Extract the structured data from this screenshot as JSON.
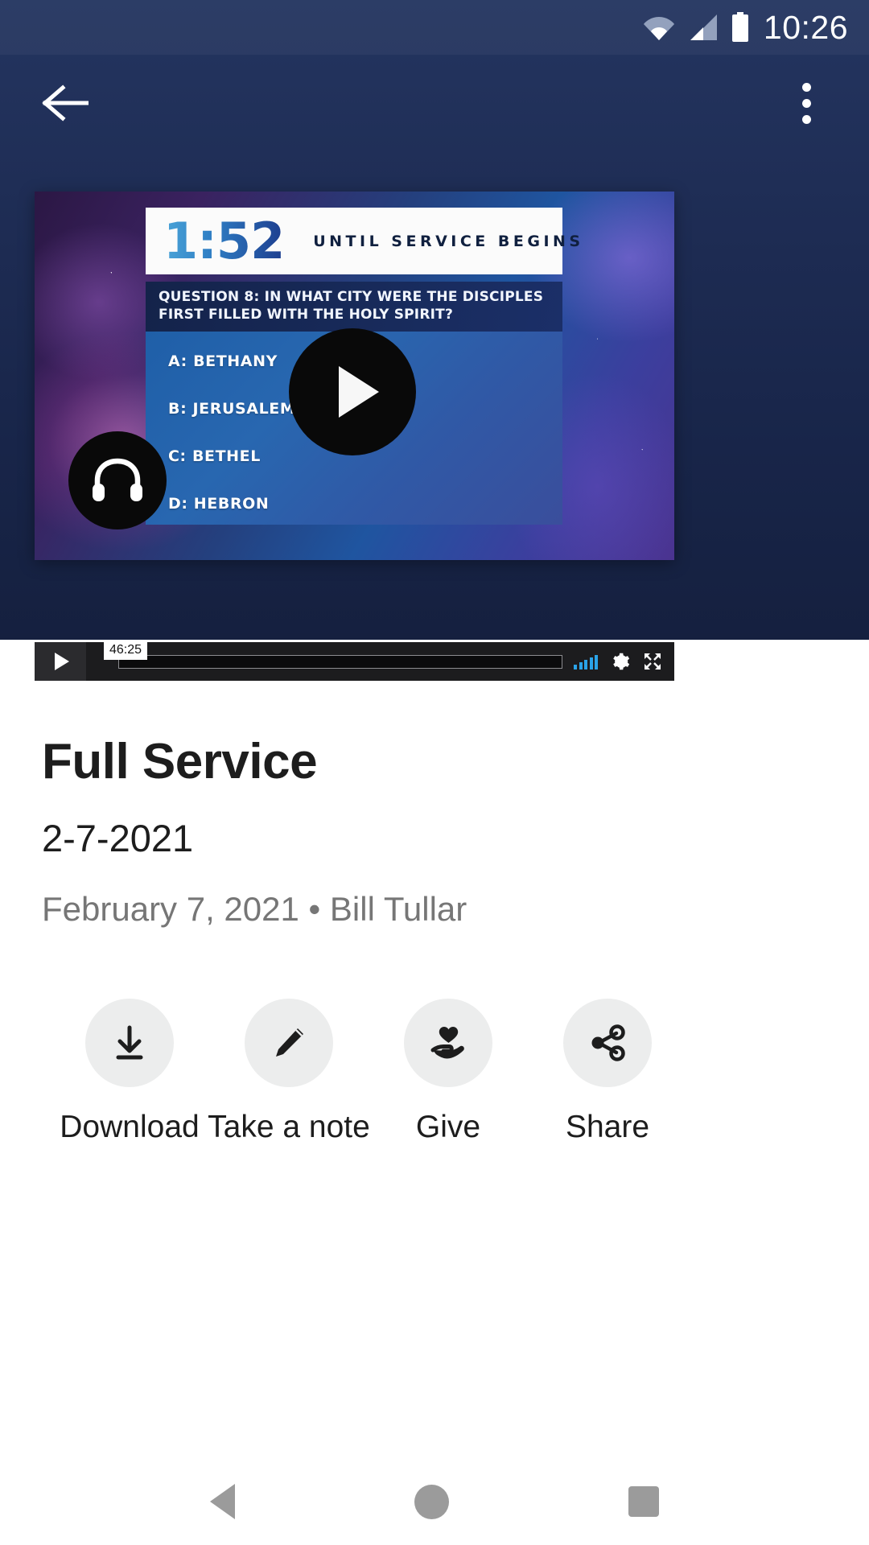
{
  "status_bar": {
    "time": "10:26",
    "icons": [
      "wifi-icon",
      "cell-signal-icon",
      "battery-icon"
    ]
  },
  "app_bar": {
    "back_icon": "arrow-left-icon",
    "overflow_icon": "more-vertical-icon"
  },
  "player": {
    "countdown": "1:52",
    "countdown_label": "UNTIL SERVICE BEGINS",
    "question": "QUESTION 8: IN WHAT CITY WERE THE DISCIPLES FIRST FILLED WITH THE HOLY SPIRIT?",
    "answers": [
      "A: BETHANY",
      "B: JERUSALEM",
      "C: BETHEL",
      "D: HEBRON"
    ],
    "play_icon": "play-icon",
    "audio_icon": "headphones-icon",
    "controls": {
      "play_icon": "play-icon",
      "duration_badge": "46:25",
      "quality_icon": "quality-bars-icon",
      "settings_icon": "gear-icon",
      "fullscreen_icon": "fullscreen-icon",
      "accent_color": "#2aa3e8"
    }
  },
  "content": {
    "title": "Full Service",
    "subtitle": "2-7-2021",
    "meta": "February 7, 2021 • Bill Tullar"
  },
  "actions": [
    {
      "label": "Download",
      "icon": "download-icon"
    },
    {
      "label": "Take a note",
      "icon": "pencil-icon"
    },
    {
      "label": "Give",
      "icon": "hand-heart-icon"
    },
    {
      "label": "Share",
      "icon": "share-nodes-icon"
    }
  ],
  "nav_bar": {
    "back_icon": "nav-back-triangle-icon",
    "home_icon": "nav-home-circle-icon",
    "recents_icon": "nav-recents-square-icon"
  },
  "colors": {
    "header_blue": "#1d2b52",
    "accent_blue": "#2aa3e8",
    "text_primary": "#1d1d1d",
    "text_muted": "#767676",
    "action_circle": "#eceded"
  }
}
